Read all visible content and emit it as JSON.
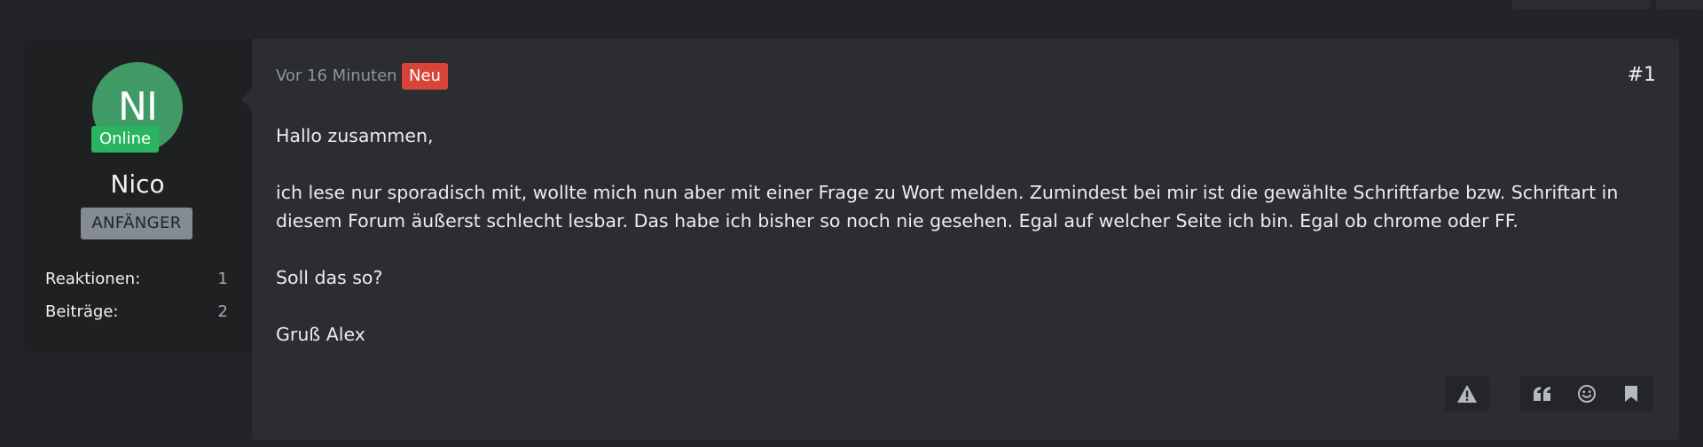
{
  "author": {
    "avatar_initials": "NI",
    "status": "Online",
    "name": "Nico",
    "rank": "ANFÄNGER",
    "stats": [
      {
        "label": "Reaktionen:",
        "value": "1"
      },
      {
        "label": "Beiträge:",
        "value": "2"
      }
    ]
  },
  "post": {
    "time": "Vor 16 Minuten",
    "badge": "Neu",
    "number": "#1",
    "paragraphs": [
      "Hallo zusammen,",
      "ich lese nur sporadisch mit, wollte mich nun aber mit einer Frage zu Wort melden. Zumindest bei mir ist die gewählte Schriftfarbe bzw. Schriftart in diesem Forum äußerst schlecht lesbar. Das habe ich bisher so noch nie gesehen. Egal auf welcher Seite ich bin. Egal ob chrome oder FF.",
      "Soll das so?",
      "Gruß Alex"
    ]
  },
  "actions": {
    "report_icon": "warning-icon",
    "quote_icon": "quote-icon",
    "react_icon": "smiley-icon",
    "bookmark_icon": "bookmark-icon"
  },
  "colors": {
    "background": "#232427",
    "panel": "#2c2d30",
    "sidebar": "#1f2022",
    "avatar": "#3f9a65",
    "online": "#29b560",
    "new_badge": "#d9443a",
    "rank_badge": "#848b93"
  }
}
